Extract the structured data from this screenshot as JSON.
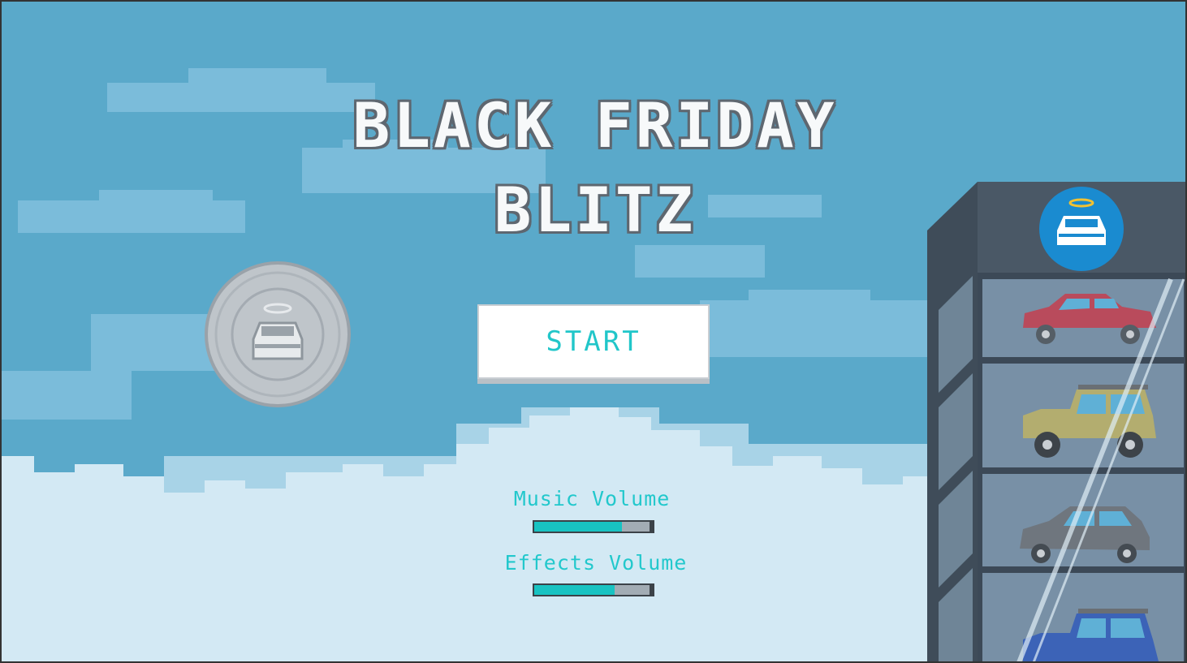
{
  "title": {
    "line1": "BLACK FRIDAY",
    "line2": "BLITZ"
  },
  "menu": {
    "start_label": "START"
  },
  "audio": {
    "music_label": "Music Volume",
    "music_level": 0.74,
    "effects_label": "Effects Volume",
    "effects_level": 0.68
  },
  "icons": {
    "coin": "car-coin-icon",
    "tower_badge": "car-angel-icon"
  },
  "showroom": {
    "cars": [
      "red-sedan",
      "yellow-jeep",
      "grey-suv",
      "blue-jeep"
    ]
  },
  "colors": {
    "sky": "#5aa9ca",
    "accent": "#22c8cc",
    "cloud_front": "#d3e9f4"
  }
}
